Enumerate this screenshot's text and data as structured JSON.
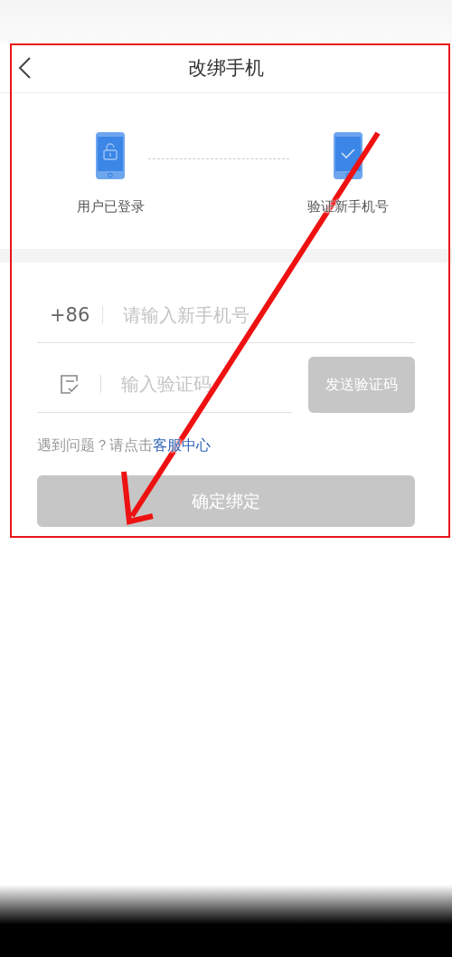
{
  "header": {
    "title": "改绑手机"
  },
  "steps": [
    {
      "label": "用户已登录",
      "kind": "unlocked"
    },
    {
      "label": "验证新手机号",
      "kind": "verify"
    }
  ],
  "phone_field": {
    "prefix": "+86",
    "placeholder": "请输入新手机号"
  },
  "code_field": {
    "placeholder": "输入验证码"
  },
  "send_code_button": {
    "label": "发送验证码",
    "disabled": true
  },
  "help": {
    "text": "遇到问题？请点击",
    "link": "客服中心"
  },
  "confirm_button": {
    "label": "确定绑定",
    "disabled": true
  }
}
